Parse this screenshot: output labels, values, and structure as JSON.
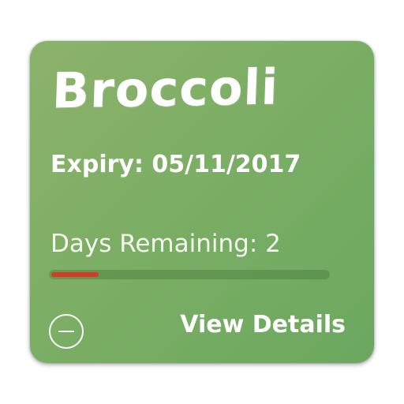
{
  "card": {
    "title": "Broccoli",
    "expiry": "Expiry: 05/11/2017",
    "days_remaining_label": "Days Remaining: 2",
    "progress_fraction": 0.17,
    "view_details_label": "View Details",
    "remove_icon": "minus-circle-icon"
  },
  "colors": {
    "card_background": "#7cae64",
    "progress_fill": "#d63a2a",
    "text": "#ffffff"
  }
}
